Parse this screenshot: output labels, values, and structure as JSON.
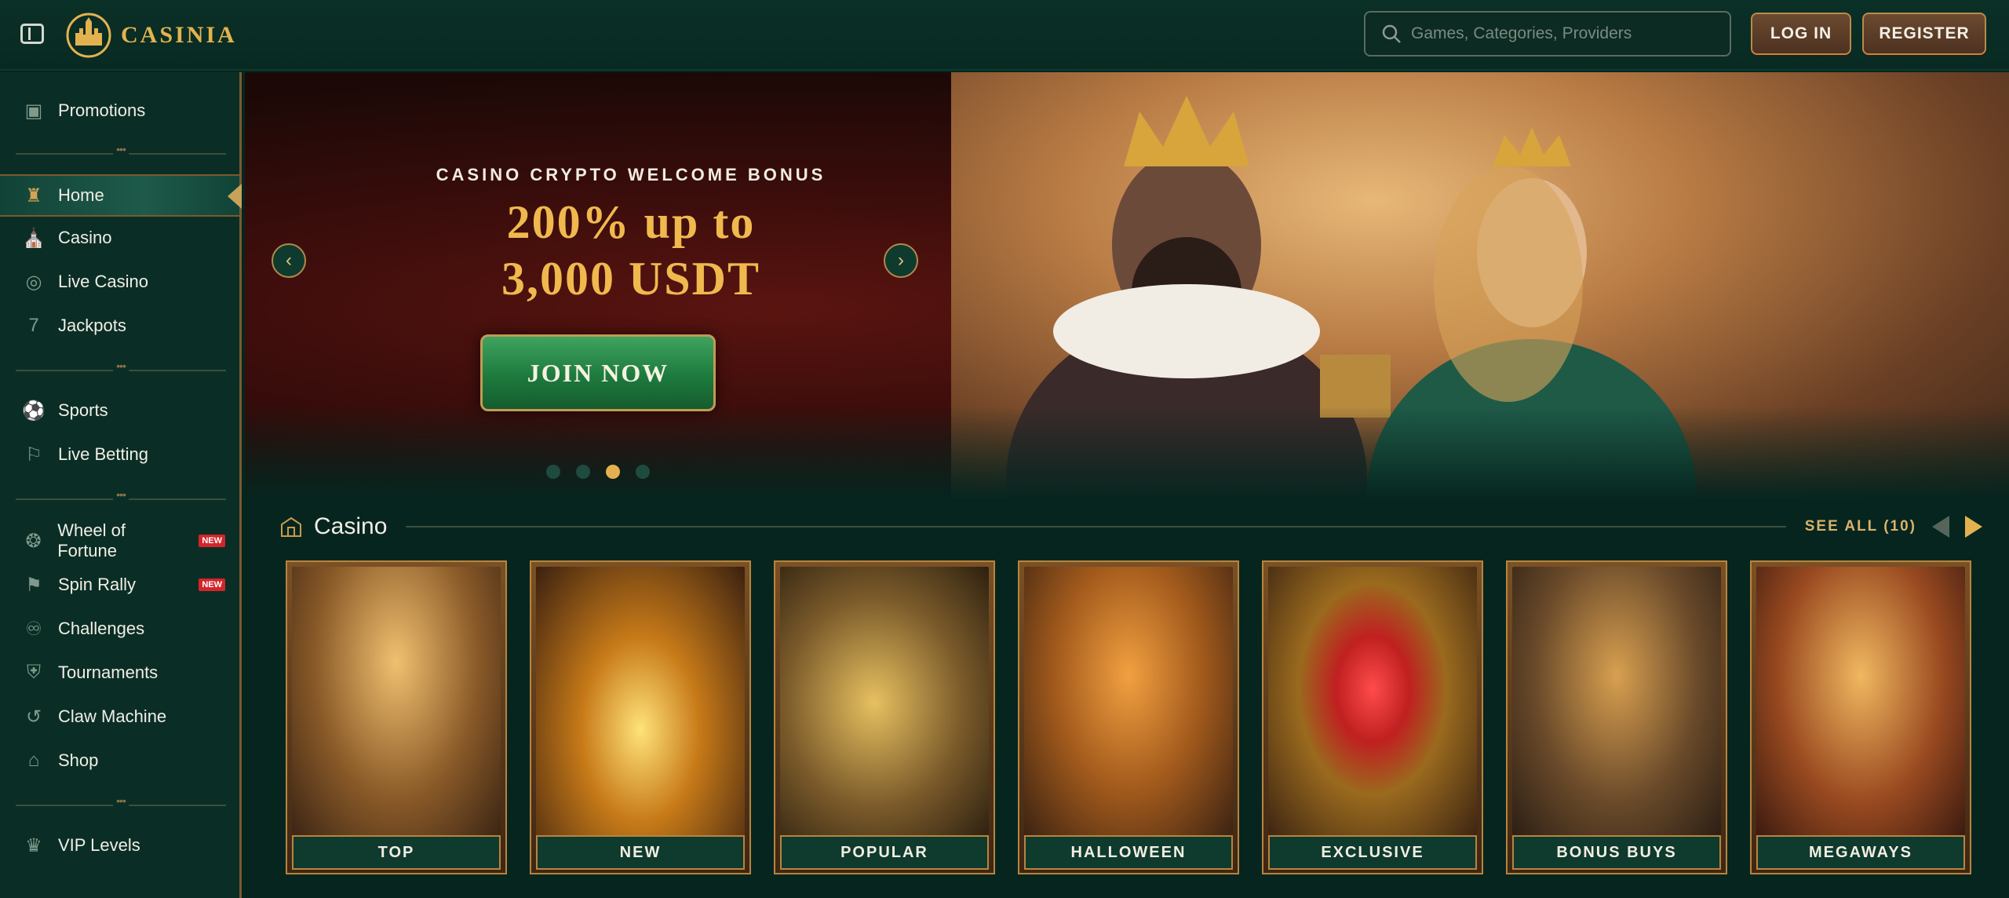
{
  "header": {
    "logo_text": "CASINIA",
    "search_placeholder": "Games, Categories, Providers",
    "login_label": "LOG IN",
    "register_label": "REGISTER"
  },
  "sidebar": {
    "items": [
      {
        "label": "Promotions",
        "icon": "gift-box-icon"
      },
      {
        "label": "Home",
        "icon": "castle-icon",
        "active": true
      },
      {
        "label": "Casino",
        "icon": "casino-building-icon"
      },
      {
        "label": "Live Casino",
        "icon": "roulette-icon"
      },
      {
        "label": "Jackpots",
        "icon": "seven-icon"
      },
      {
        "label": "Sports",
        "icon": "soccer-ball-icon"
      },
      {
        "label": "Live Betting",
        "icon": "banner-icon"
      },
      {
        "label": "Wheel of Fortune",
        "icon": "wheel-icon",
        "badge": "NEW"
      },
      {
        "label": "Spin Rally",
        "icon": "flag-icon",
        "badge": "NEW"
      },
      {
        "label": "Challenges",
        "icon": "bell-icon"
      },
      {
        "label": "Tournaments",
        "icon": "trophy-icon"
      },
      {
        "label": "Claw Machine",
        "icon": "claw-icon"
      },
      {
        "label": "Shop",
        "icon": "shop-icon"
      },
      {
        "label": "VIP Levels",
        "icon": "crown-icon"
      }
    ]
  },
  "hero": {
    "subtitle": "CASINO CRYPTO WELCOME BONUS",
    "title_line1": "200% up to",
    "title_line2": "3,000 USDT",
    "cta_label": "JOIN NOW",
    "slide_count": 4,
    "active_slide": 3
  },
  "casino_section": {
    "title": "Casino",
    "see_all": "SEE ALL (10)",
    "categories": [
      "TOP",
      "NEW",
      "POPULAR",
      "HALLOWEEN",
      "EXCLUSIVE",
      "BONUS BUYS",
      "MEGAWAYS"
    ]
  },
  "colors": {
    "background": "#06251f",
    "accent_gold": "#e3b24f",
    "sidebar_border": "#7a5a2e",
    "badge_red": "#d2252a"
  }
}
